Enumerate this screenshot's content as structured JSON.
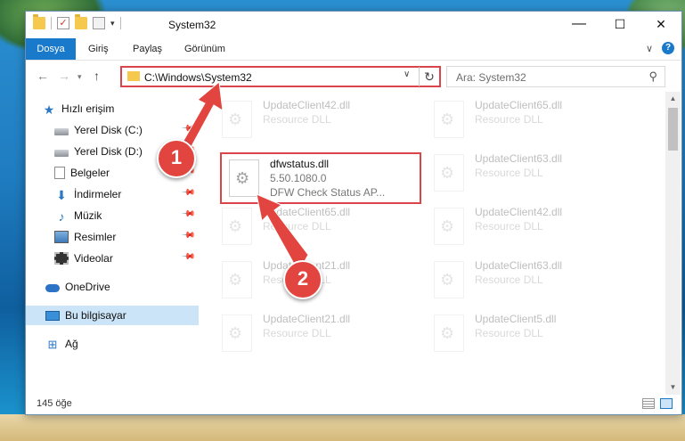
{
  "window": {
    "title": "System32"
  },
  "titlebar": {
    "minimize": "—",
    "maximize": "☐",
    "close": "✕"
  },
  "ribbon": {
    "tabs": [
      "Dosya",
      "Giriş",
      "Paylaş",
      "Görünüm"
    ],
    "help": "?"
  },
  "navbar": {
    "address": "C:\\Windows\\System32",
    "search_placeholder": "Ara: System32"
  },
  "sidebar": {
    "items": [
      {
        "label": "Hızlı erişim",
        "icon": "star-icon"
      },
      {
        "label": "Yerel Disk (C:)",
        "icon": "drive-icon"
      },
      {
        "label": "Yerel Disk (D:)",
        "icon": "drive-icon"
      },
      {
        "label": "Belgeler",
        "icon": "documents-icon"
      },
      {
        "label": "İndirmeler",
        "icon": "download-icon"
      },
      {
        "label": "Müzik",
        "icon": "music-icon"
      },
      {
        "label": "Resimler",
        "icon": "pictures-icon"
      },
      {
        "label": "Videolar",
        "icon": "videos-icon"
      },
      {
        "label": "OneDrive",
        "icon": "cloud-icon"
      },
      {
        "label": "Bu bilgisayar",
        "icon": "computer-icon"
      },
      {
        "label": "Ağ",
        "icon": "network-icon"
      }
    ]
  },
  "files": {
    "left": [
      {
        "name": "UpdateClient42.dll",
        "type": "Resource DLL"
      },
      {
        "name": "UpdateClient65.dll",
        "type": "Resource DLL"
      },
      {
        "name": "UpdateClient21.dll",
        "type": "Resource DLL"
      },
      {
        "name": "UpdateClient21.dll",
        "type": "Resource DLL"
      }
    ],
    "right": [
      {
        "name": "UpdateClient65.dll",
        "type": "Resource DLL"
      },
      {
        "name": "UpdateClient63.dll",
        "type": "Resource DLL"
      },
      {
        "name": "UpdateClient42.dll",
        "type": "Resource DLL"
      },
      {
        "name": "UpdateClient63.dll",
        "type": "Resource DLL"
      },
      {
        "name": "UpdateClient5.dll",
        "type": "Resource DLL"
      }
    ],
    "selected": {
      "name": "dfwstatus.dll",
      "version": "5.50.1080.0",
      "description": "DFW Check Status AP..."
    }
  },
  "status": {
    "item_count": "145 öğe"
  },
  "annotations": {
    "step1": "1",
    "step2": "2",
    "color": "#e2453f"
  }
}
